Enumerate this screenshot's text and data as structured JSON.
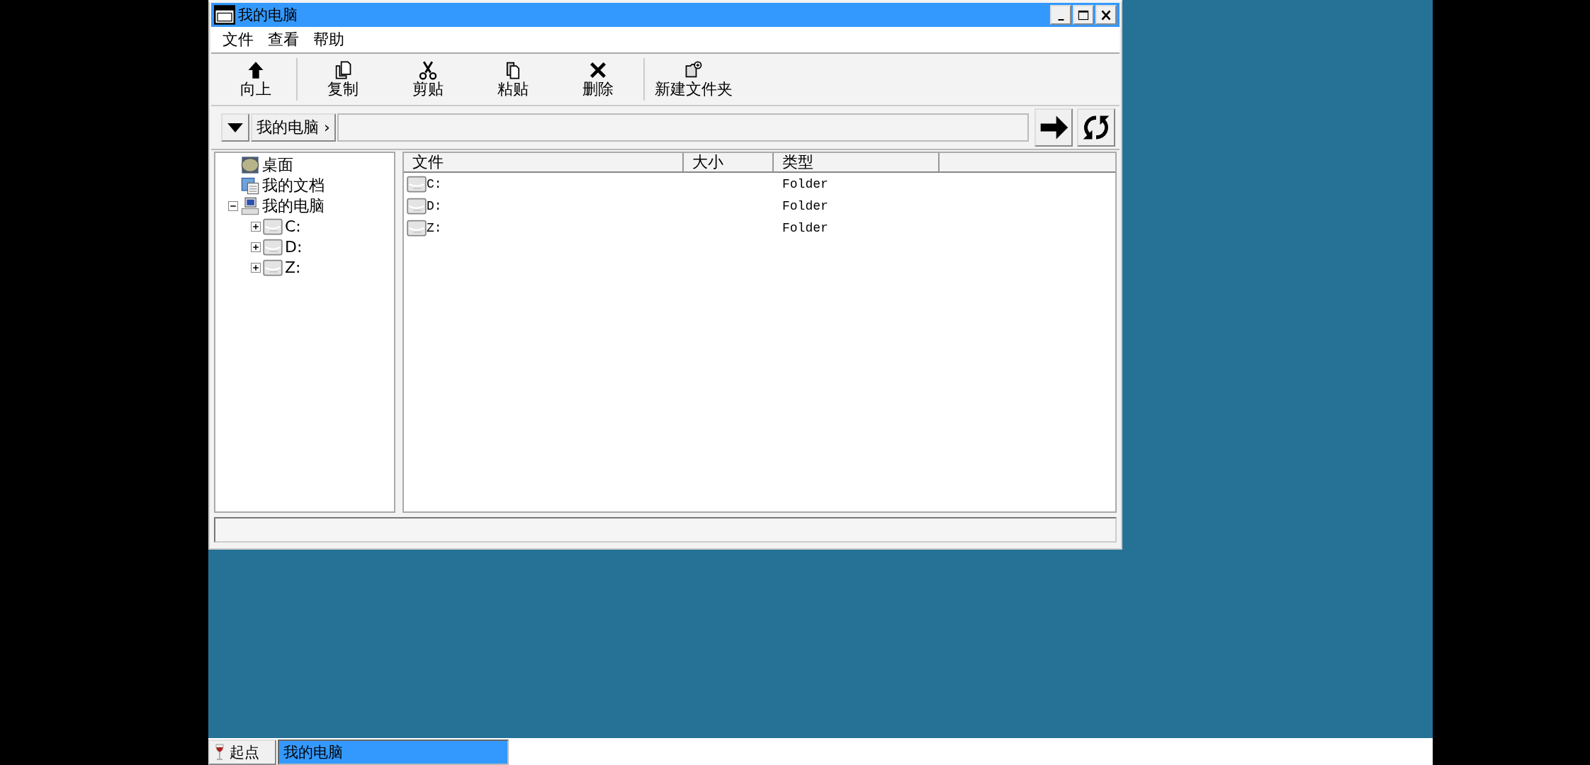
{
  "window": {
    "title": "我的电脑",
    "controls": [
      {
        "kind": "minimize"
      },
      {
        "kind": "maximize"
      },
      {
        "kind": "close"
      }
    ]
  },
  "menu": [
    "文件",
    "查看",
    "帮助"
  ],
  "toolbar": [
    {
      "kind": "up",
      "label": "向上"
    },
    {
      "kind": "copy",
      "label": "复制"
    },
    {
      "kind": "cut",
      "label": "剪贴"
    },
    {
      "kind": "paste",
      "label": "粘贴"
    },
    {
      "kind": "delete",
      "label": "删除"
    },
    {
      "kind": "new_folder",
      "label": "新建文件夹"
    }
  ],
  "address": {
    "breadcrumb": "我的电脑 ›",
    "buttons": [
      {
        "kind": "go"
      },
      {
        "kind": "refresh"
      }
    ]
  },
  "tree": [
    {
      "kind": "desktop",
      "label": "桌面"
    },
    {
      "kind": "documents",
      "label": "我的文档"
    },
    {
      "kind": "computer",
      "label": "我的电脑",
      "expanded": true,
      "children": [
        {
          "kind": "drive",
          "label": "C:",
          "expanded": false
        },
        {
          "kind": "drive",
          "label": "D:",
          "expanded": false
        },
        {
          "kind": "drive",
          "label": "Z:",
          "expanded": false
        }
      ]
    }
  ],
  "list": {
    "columns": [
      "文件",
      "大小",
      "类型"
    ],
    "rows": [
      {
        "name": "C:",
        "type": "Folder"
      },
      {
        "name": "D:",
        "type": "Folder"
      },
      {
        "name": "Z:",
        "type": "Folder"
      }
    ]
  },
  "taskbar": {
    "start": "起点",
    "tasks": [
      {
        "label": "我的电脑",
        "selected": true
      }
    ]
  }
}
